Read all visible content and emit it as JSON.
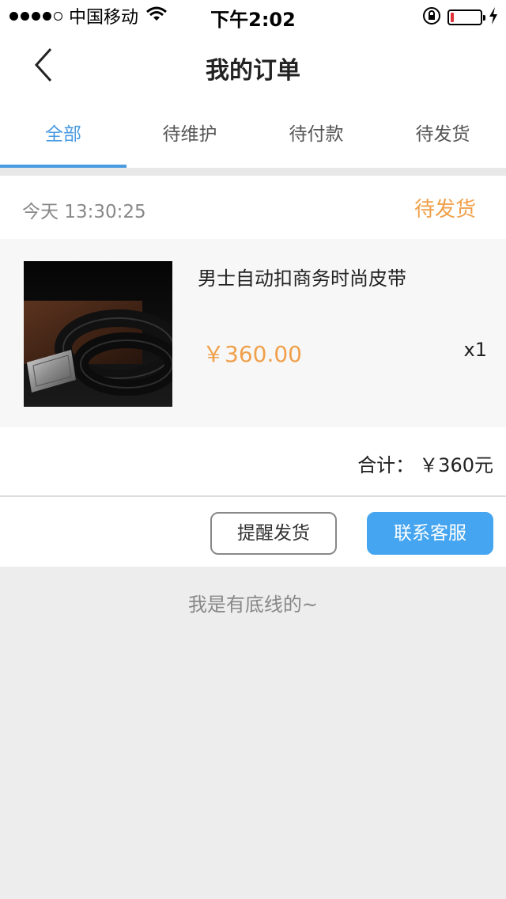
{
  "status_bar": {
    "carrier": "中国移动",
    "time": "下午2:02",
    "battery_level": 0.1,
    "battery_color": "#e0343a"
  },
  "navbar": {
    "title": "我的订单",
    "back_icon": "chevron-left-icon"
  },
  "tabs": [
    {
      "label": "全部",
      "active": true
    },
    {
      "label": "待维护",
      "active": false
    },
    {
      "label": "待付款",
      "active": false
    },
    {
      "label": "待发货",
      "active": false
    }
  ],
  "colors": {
    "accent_blue": "#4a9be0",
    "button_blue": "#45a5f0",
    "price_orange": "#f0a04a",
    "background_gray": "#ededed"
  },
  "order": {
    "time": "今天 13:30:25",
    "status": "待发货",
    "product": {
      "name": "男士自动扣商务时尚皮带",
      "price": "￥360.00",
      "quantity": "x1",
      "image_icon": "belt-product-image"
    },
    "total_label": "合计：",
    "total_value": "￥360元",
    "buttons": {
      "remind": "提醒发货",
      "contact": "联系客服"
    }
  },
  "footer": {
    "text": "我是有底线的~"
  }
}
